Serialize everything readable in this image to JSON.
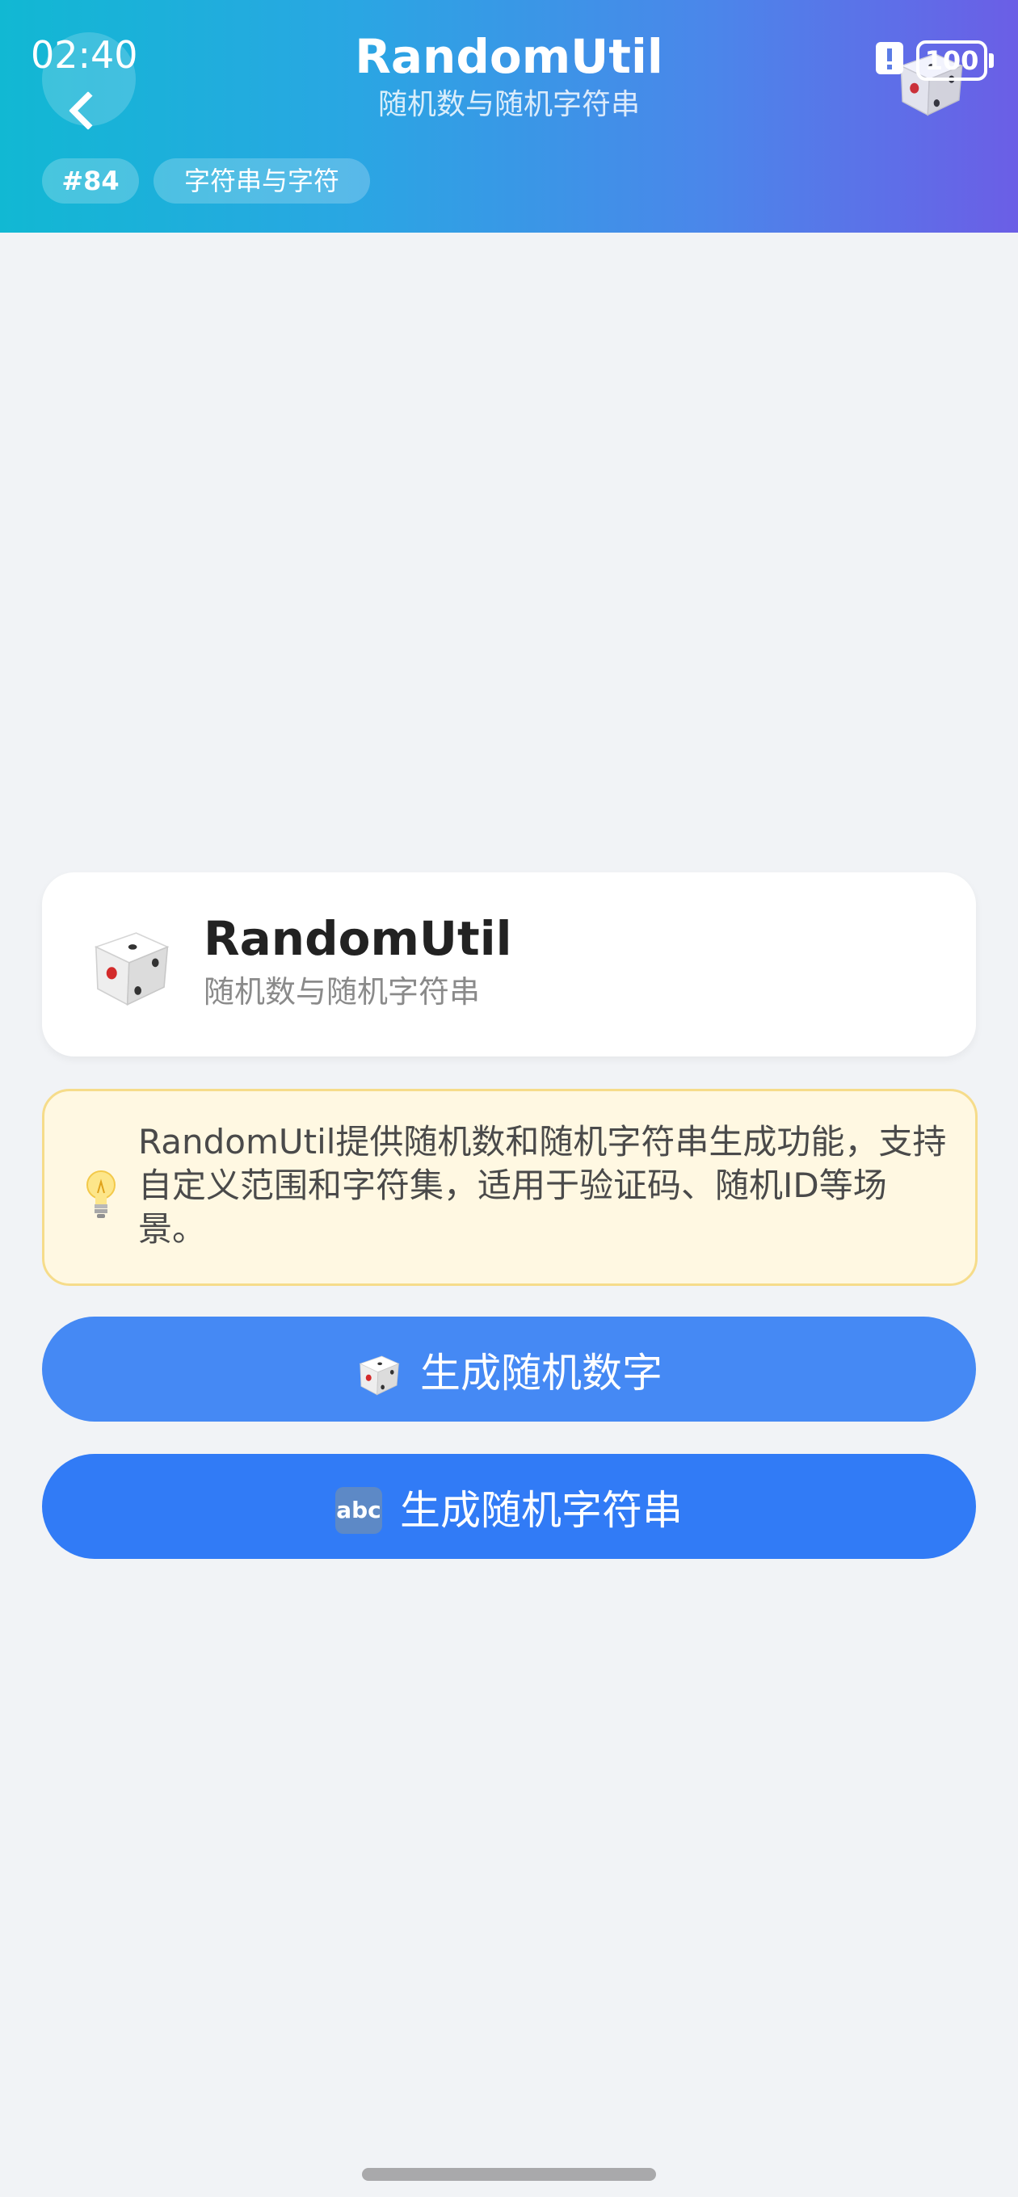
{
  "status_bar": {
    "time": "02:40",
    "battery": "100"
  },
  "header": {
    "title": "RandomUtil",
    "subtitle": "随机数与随机字符串",
    "chips": [
      "#84",
      "字符串与字符"
    ],
    "icon": "dice-icon"
  },
  "card": {
    "title": "RandomUtil",
    "subtitle": "随机数与随机字符串",
    "icon": "dice-icon"
  },
  "tip": {
    "icon": "light-bulb-icon",
    "text": "RandomUtil提供随机数和随机字符串生成功能，支持自定义范围和字符集，适用于验证码、随机ID等场景。"
  },
  "buttons": {
    "random_number": {
      "label": "生成随机数字",
      "icon": "dice-icon"
    },
    "random_string": {
      "label": "生成随机字符串",
      "icon": "abc-icon",
      "icon_text": "abc"
    }
  },
  "colors": {
    "header_gradient_start": "#11b8d3",
    "header_gradient_end": "#6b5ee6",
    "button_number": "#4589f4",
    "button_string": "#317bf6",
    "tip_background": "#fff8e2",
    "tip_border": "#f6dc8a",
    "page_background": "#f1f3f6"
  }
}
